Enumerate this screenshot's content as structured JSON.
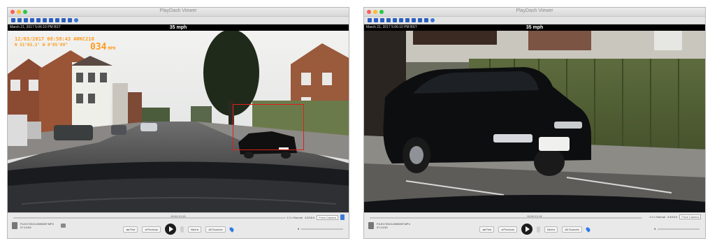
{
  "window_title": "PlayDash Viewer",
  "toolbar_icons": [
    "folder-icon",
    "copy-icon",
    "filter-icon",
    "filter-icon",
    "filter-icon",
    "filter-icon",
    "filter-icon",
    "grid-icon",
    "grid-icon",
    "expand-icon",
    "settings-icon"
  ],
  "left": {
    "info_date": "March 21, 2017 5:06:10 PM BST",
    "speed": "35 mph",
    "overlay_line1": "12/03/2017 08:58:43  ##KC210",
    "overlay_line2": "N 51°03.2' W  0°05'09\"",
    "overlay_speed": "034",
    "overlay_speed_unit": "MPH",
    "scrub_time": "00:00:13.15",
    "speed_label": "1.0 x Normal",
    "format_label": "4:3/16:9",
    "format_value": "Front Camera",
    "file_name": "FILE170310-085926F.MP4",
    "file_time": "07:13:59",
    "btn_first": "◂◂ First",
    "btn_prev": "◂ Previous",
    "btn_next": "Next ▸",
    "btn_last": "All Sources",
    "colors": {
      "overlay": "#ff9a1e",
      "detection": "#e0201c",
      "accent": "#3a7bdc"
    }
  },
  "right": {
    "info_date": "March 21, 2017 5:06:10 PM BST",
    "speed": "35 mph",
    "scrub_time": "00:00:13.15",
    "speed_label": "1.0 x Normal",
    "format_label": "4:3/16:9",
    "format_value": "Front Camera",
    "file_name": "FILE170310-085926F.MP4",
    "file_time": "07:13:59",
    "btn_first": "◂◂ First",
    "btn_prev": "◂ Previous",
    "btn_next": "Next ▸",
    "btn_last": "All Sources"
  }
}
